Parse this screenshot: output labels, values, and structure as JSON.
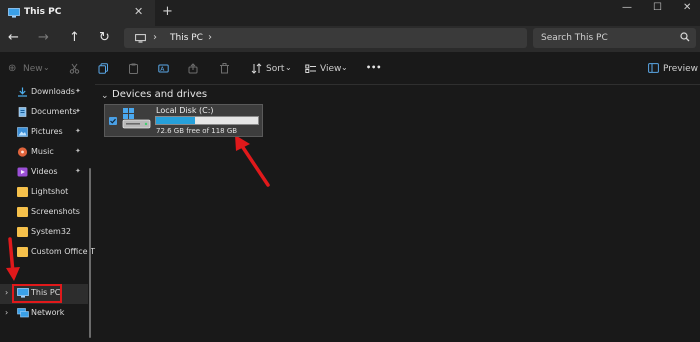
{
  "titlebar": {
    "tab_label": "This PC",
    "close_glyph": "✕",
    "new_tab_glyph": "+",
    "minimize_glyph": "—",
    "maximize_glyph": "☐",
    "close_window_glyph": "✕"
  },
  "navbar": {
    "back_glyph": "←",
    "forward_glyph": "→",
    "up_glyph": "↑",
    "refresh_glyph": "↻",
    "address_label": "This PC",
    "chevron": "›",
    "search_placeholder": "Search This PC"
  },
  "commandbar": {
    "new_label": "New",
    "new_glyph": "⊕",
    "sort_label": "Sort",
    "view_label": "View",
    "more_glyph": "•••",
    "preview_label": "Preview"
  },
  "sidebar": {
    "items": [
      {
        "label": "Downloads",
        "icon": "download-icon",
        "pinned": true
      },
      {
        "label": "Documents",
        "icon": "documents-icon",
        "pinned": true
      },
      {
        "label": "Pictures",
        "icon": "pictures-icon",
        "pinned": true
      },
      {
        "label": "Music",
        "icon": "music-icon",
        "pinned": true
      },
      {
        "label": "Videos",
        "icon": "videos-icon",
        "pinned": true
      },
      {
        "label": "Lightshot",
        "icon": "folder-icon",
        "pinned": false
      },
      {
        "label": "Screenshots",
        "icon": "folder-icon",
        "pinned": false
      },
      {
        "label": "System32",
        "icon": "folder-icon",
        "pinned": false
      },
      {
        "label": "Custom Office T",
        "icon": "folder-icon",
        "pinned": false
      }
    ],
    "pin_glyph": "📌",
    "this_pc_label": "This PC",
    "network_label": "Network",
    "expander_glyph": "›"
  },
  "main": {
    "group_label": "Devices and drives",
    "group_chevron": "⌄",
    "drive": {
      "name": "Local Disk (C:)",
      "space": "72.6 GB free of 118 GB",
      "used_fraction": 0.385
    }
  },
  "colors": {
    "accent": "#26a0da",
    "annotation_red": "#e0191b",
    "folder": "#f5c04b"
  }
}
